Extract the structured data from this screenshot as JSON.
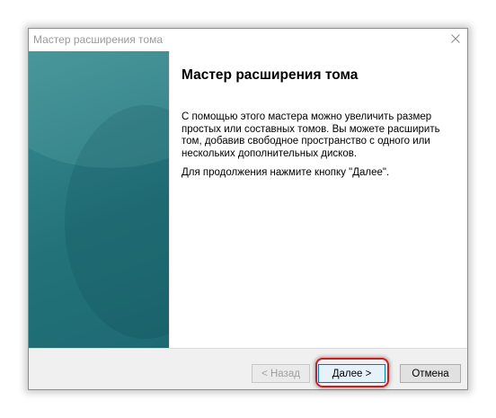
{
  "window": {
    "title": "Мастер расширения тома",
    "close_icon": "close-icon"
  },
  "main": {
    "heading": "Мастер расширения тома",
    "intro_text": "С помощью этого мастера можно увеличить размер простых или составных томов. Вы можете расширить том, добавив свободное пространство с одного или нескольких дополнительных дисков.",
    "continue_text": "Для продолжения нажмите кнопку \"Далее\"."
  },
  "footer": {
    "back_label": "< Назад",
    "back_enabled": false,
    "next_label": "Далее >",
    "cancel_label": "Отмена"
  },
  "colors": {
    "side_panel": "#237279",
    "highlight": "#cc1e1e",
    "default_button_border": "#0078d7"
  }
}
